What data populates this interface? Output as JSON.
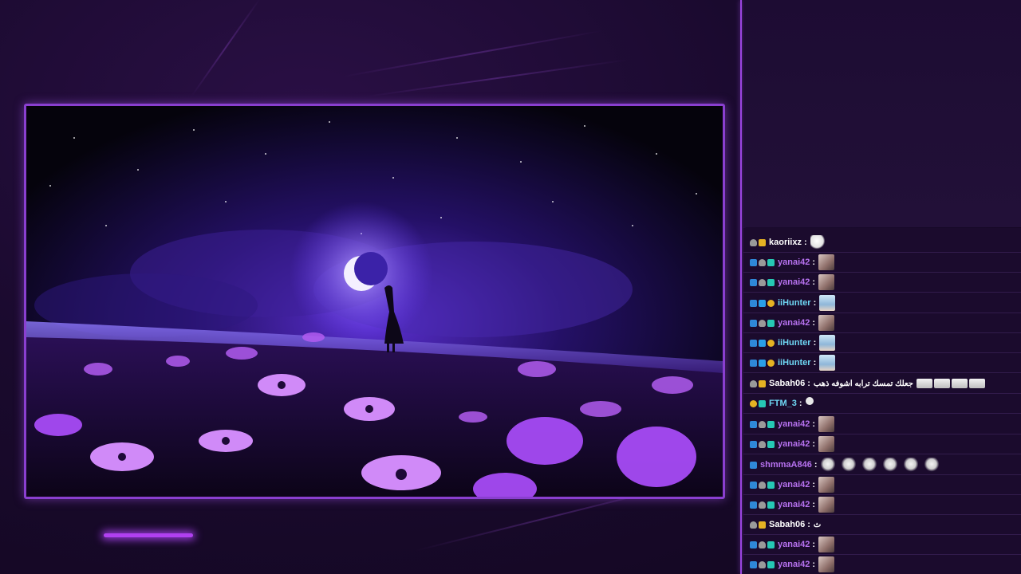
{
  "colors": {
    "accent": "#9a45e0",
    "background": "#1a0a2e",
    "username_purple": "#b772f0",
    "username_teal": "#6fd8f5",
    "username_white": "#ffffff"
  },
  "chat": {
    "messages": [
      {
        "user": "kaoriixz",
        "color": "#ffffff",
        "badges": [
          "grey",
          "crown"
        ],
        "text": "",
        "emotes": [
          "ghost"
        ]
      },
      {
        "user": "yanai42",
        "color": "#b772f0",
        "badges": [
          "prime",
          "grey",
          "sub"
        ],
        "text": "",
        "emotes": [
          "cat"
        ]
      },
      {
        "user": "yanai42",
        "color": "#b772f0",
        "badges": [
          "prime",
          "grey",
          "sub"
        ],
        "text": "",
        "emotes": [
          "cat"
        ]
      },
      {
        "user": "iiHunter",
        "color": "#6fd8f5",
        "badges": [
          "prime",
          "cube",
          "bits"
        ],
        "text": "",
        "emotes": [
          "anime"
        ]
      },
      {
        "user": "yanai42",
        "color": "#b772f0",
        "badges": [
          "prime",
          "grey",
          "sub"
        ],
        "text": "",
        "emotes": [
          "cat"
        ]
      },
      {
        "user": "iiHunter",
        "color": "#6fd8f5",
        "badges": [
          "prime",
          "cube",
          "bits"
        ],
        "text": "",
        "emotes": [
          "anime"
        ]
      },
      {
        "user": "iiHunter",
        "color": "#6fd8f5",
        "badges": [
          "prime",
          "cube",
          "bits"
        ],
        "text": "",
        "emotes": [
          "anime"
        ]
      },
      {
        "user": "Sabah06",
        "color": "#ffffff",
        "badges": [
          "grey",
          "crown"
        ],
        "text": "جعلك تمسك ترابه اشوفه ذهب",
        "emotes": [
          "bars",
          "bars",
          "bars",
          "bars"
        ]
      },
      {
        "user": "FTM_3",
        "color": "#6fd8f5",
        "badges": [
          "bits",
          "sub"
        ],
        "text": "",
        "emotes": [
          "small"
        ]
      },
      {
        "user": "yanai42",
        "color": "#b772f0",
        "badges": [
          "prime",
          "grey",
          "sub"
        ],
        "text": "",
        "emotes": [
          "cat"
        ]
      },
      {
        "user": "yanai42",
        "color": "#b772f0",
        "badges": [
          "prime",
          "grey",
          "sub"
        ],
        "text": "",
        "emotes": [
          "cat"
        ]
      },
      {
        "user": "shmmaA846",
        "color": "#b772f0",
        "badges": [
          "prime"
        ],
        "text": "",
        "emotes": [
          "sketch",
          "sketch",
          "sketch",
          "sketch",
          "sketch",
          "sketch"
        ]
      },
      {
        "user": "yanai42",
        "color": "#b772f0",
        "badges": [
          "prime",
          "grey",
          "sub"
        ],
        "text": "",
        "emotes": [
          "cat"
        ]
      },
      {
        "user": "yanai42",
        "color": "#b772f0",
        "badges": [
          "prime",
          "grey",
          "sub"
        ],
        "text": "",
        "emotes": [
          "cat"
        ]
      },
      {
        "user": "Sabah06",
        "color": "#ffffff",
        "badges": [
          "grey",
          "crown"
        ],
        "text": "ث",
        "emotes": []
      },
      {
        "user": "yanai42",
        "color": "#b772f0",
        "badges": [
          "prime",
          "grey",
          "sub"
        ],
        "text": "",
        "emotes": [
          "cat"
        ]
      },
      {
        "user": "yanai42",
        "color": "#b772f0",
        "badges": [
          "prime",
          "grey",
          "sub"
        ],
        "text": "",
        "emotes": [
          "cat"
        ]
      }
    ]
  }
}
